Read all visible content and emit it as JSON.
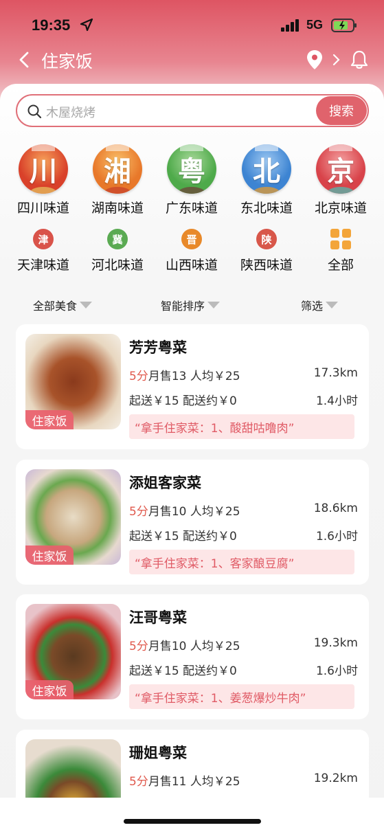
{
  "status_bar": {
    "time": "19:35",
    "network": "5G"
  },
  "nav": {
    "title": "住家饭"
  },
  "search": {
    "placeholder": "木屋烧烤",
    "button_label": "搜索"
  },
  "cuisines_primary": [
    {
      "char": "川",
      "label": "四川味道",
      "color": "#d9412a",
      "accent": "#f6a25a",
      "food": "#e4b55a"
    },
    {
      "char": "湘",
      "label": "湖南味道",
      "color": "#e8782a",
      "accent": "#f9c06a",
      "food": "#c9462a"
    },
    {
      "char": "粤",
      "label": "广东味道",
      "color": "#4eaa4a",
      "accent": "#a9d99a",
      "food": "#6b4b3a"
    },
    {
      "char": "北",
      "label": "东北味道",
      "color": "#3d84d2",
      "accent": "#9dc8f2",
      "food": "#d99a3a"
    },
    {
      "char": "京",
      "label": "北京味道",
      "color": "#d8434a",
      "accent": "#f4a0a0",
      "food": "#5ab2a8"
    }
  ],
  "cuisines_secondary": [
    {
      "char": "津",
      "label": "天津味道",
      "color": "#d9534a"
    },
    {
      "char": "冀",
      "label": "河北味道",
      "color": "#5aaa52"
    },
    {
      "char": "晋",
      "label": "山西味道",
      "color": "#e8892a"
    },
    {
      "char": "陕",
      "label": "陕西味道",
      "color": "#d8574a"
    }
  ],
  "all_label": "全部",
  "filters": {
    "category": "全部美食",
    "sort": "智能排序",
    "filter": "筛选"
  },
  "restaurants": [
    {
      "name": "芳芳粤菜",
      "score": "5分",
      "sales": "月售13",
      "avg": "人均￥25",
      "distance": "17.3km",
      "min_order": "起送￥15",
      "delivery": "配送约￥0",
      "time": "1.4小时",
      "promo": "“拿手住家菜：1、酸甜咕噜肉”",
      "tag": "住家饭"
    },
    {
      "name": "添姐客家菜",
      "score": "5分",
      "sales": "月售10",
      "avg": "人均￥25",
      "distance": "18.6km",
      "min_order": "起送￥15",
      "delivery": "配送约￥0",
      "time": "1.6小时",
      "promo": "“拿手住家菜：1、客家酿豆腐”",
      "tag": "住家饭"
    },
    {
      "name": "汪哥粤菜",
      "score": "5分",
      "sales": "月售10",
      "avg": "人均￥25",
      "distance": "19.3km",
      "min_order": "起送￥15",
      "delivery": "配送约￥0",
      "time": "1.6小时",
      "promo": "“拿手住家菜：1、姜葱爆炒牛肉”",
      "tag": "住家饭"
    },
    {
      "name": "珊姐粤菜",
      "score": "5分",
      "sales": "月售11",
      "avg": "人均￥25",
      "distance": "19.2km"
    }
  ],
  "icons": {
    "back": "chevron-left-icon",
    "location": "location-pin-icon",
    "bell": "bell-icon",
    "search": "search-icon",
    "all": "grid-icon"
  },
  "colors": {
    "brand": "#de5563",
    "score": "#e05a4e",
    "promo_bg": "#fde6e7",
    "promo_text": "#e05a65"
  }
}
